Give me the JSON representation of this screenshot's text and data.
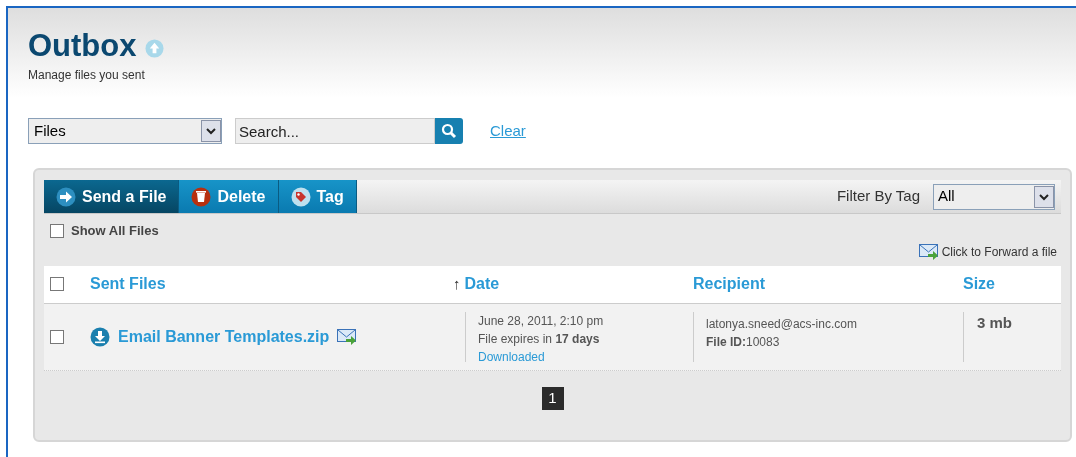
{
  "header": {
    "title": "Outbox",
    "subtitle": "Manage files you sent"
  },
  "filters": {
    "scope": "Files",
    "search_placeholder": "Search...",
    "clear": "Clear"
  },
  "toolbar": {
    "buttons": [
      {
        "kind": "send",
        "label": "Send a File"
      },
      {
        "kind": "delete",
        "label": "Delete"
      },
      {
        "kind": "tag",
        "label": "Tag"
      }
    ],
    "filter_label": "Filter By Tag",
    "filter_value": "All"
  },
  "show_all": {
    "label": "Show All Files",
    "checked": false
  },
  "forward_link": "Click to Forward a file",
  "table": {
    "select_all_checked": false,
    "columns": [
      {
        "label": "Sent Files"
      },
      {
        "label": "Date",
        "sort_arrow": "↑"
      },
      {
        "label": "Recipient"
      },
      {
        "label": "Size"
      }
    ],
    "rows": [
      {
        "checked": false,
        "file": "Email Banner Templates.zip",
        "date": "June 28, 2011, 2:10 pm",
        "expires": "File expires in **17 days**",
        "status": "Downloaded",
        "recipient": "latonya.sneed@acs-inc.com",
        "file_id": "**File ID:**10083",
        "size": "3 mb"
      }
    ]
  },
  "pagination": [
    {
      "label": "1",
      "selected": true
    }
  ]
}
